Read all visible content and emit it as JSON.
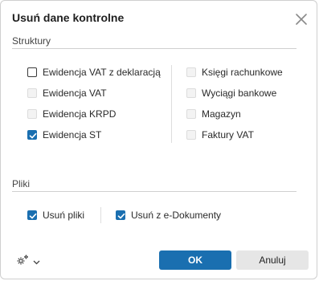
{
  "dialog": {
    "title": "Usuń dane kontrolne"
  },
  "structures": {
    "label": "Struktury",
    "left": [
      {
        "label": "Ewidencja VAT z deklaracją",
        "state": "unchecked"
      },
      {
        "label": "Ewidencja VAT",
        "state": "disabled"
      },
      {
        "label": "Ewidencja KRPD",
        "state": "disabled"
      },
      {
        "label": "Ewidencja ST",
        "state": "checked"
      }
    ],
    "right": [
      {
        "label": "Księgi rachunkowe",
        "state": "disabled"
      },
      {
        "label": "Wyciągi bankowe",
        "state": "disabled"
      },
      {
        "label": "Magazyn",
        "state": "disabled"
      },
      {
        "label": "Faktury VAT",
        "state": "disabled"
      }
    ]
  },
  "files": {
    "label": "Pliki",
    "delete_files": {
      "label": "Usuń pliki",
      "state": "checked"
    },
    "delete_edocs": {
      "label": "Usuń z e-Dokumenty",
      "state": "checked"
    }
  },
  "footer": {
    "ok_label": "OK",
    "cancel_label": "Anuluj",
    "settings_icon": "gear-icon",
    "menu_icon": "chevron-down-icon"
  },
  "colors": {
    "accent": "#1a6fb0",
    "cancel_bg": "#e6e6e6"
  }
}
